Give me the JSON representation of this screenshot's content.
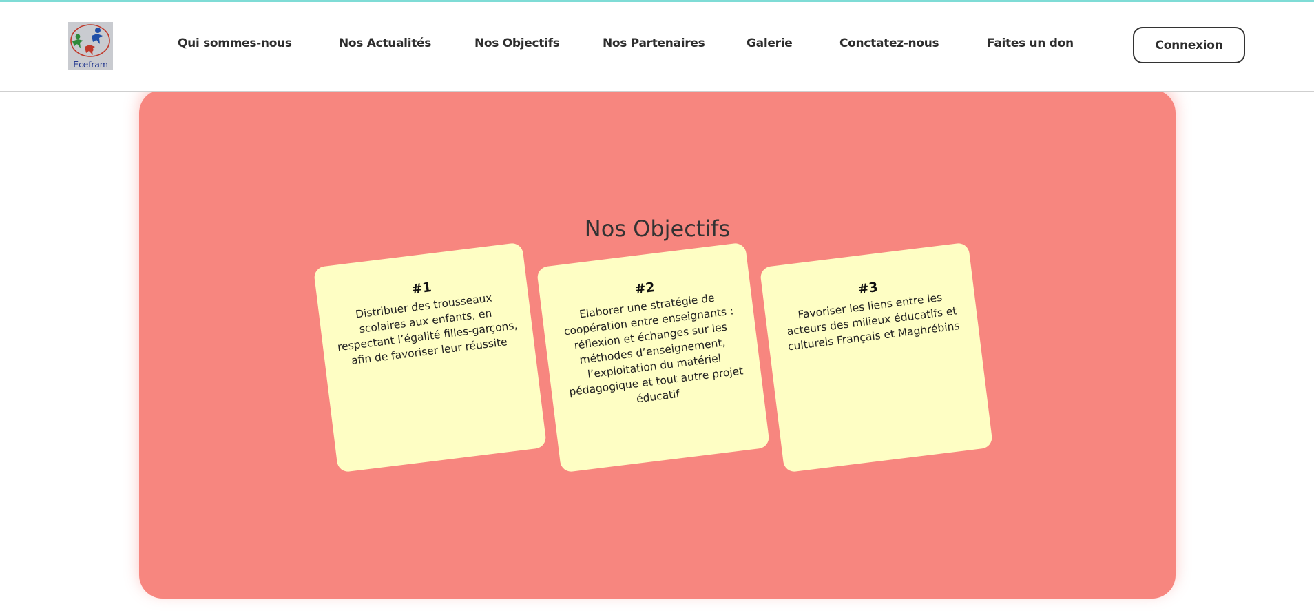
{
  "header": {
    "logo_text": "Ecefram",
    "nav": [
      {
        "label": "Qui sommes-nous"
      },
      {
        "label": "Nos Actualités"
      },
      {
        "label": "Nos Objectifs"
      },
      {
        "label": "Nos Partenaires"
      },
      {
        "label": "Galerie"
      },
      {
        "label": "Conctatez-nous"
      },
      {
        "label": "Faites un don"
      }
    ],
    "login_label": "Connexion"
  },
  "objectives": {
    "title": "Nos Objectifs",
    "cards": [
      {
        "number": "#1",
        "text": "Distribuer des trousseaux scolaires aux enfants, en respectant l’égalité filles-garçons, afin de favoriser leur réussite"
      },
      {
        "number": "#2",
        "text": "Elaborer une stratégie de coopération entre enseignants : réflexion et échanges sur les méthodes d’enseignement, l’exploitation du matériel pédagogique et tout autre projet éducatif"
      },
      {
        "number": "#3",
        "text": "Favoriser les liens entre les acteurs des milieux éducatifs et culturels Français et Maghrébins"
      }
    ]
  },
  "colors": {
    "accent_line": "#7fdcd6",
    "panel_background": "#f7867f",
    "card_background": "#fefec4",
    "text_dark": "#2d2d2d"
  },
  "icons": {
    "logo": "ecefram-logo-people-circle"
  }
}
